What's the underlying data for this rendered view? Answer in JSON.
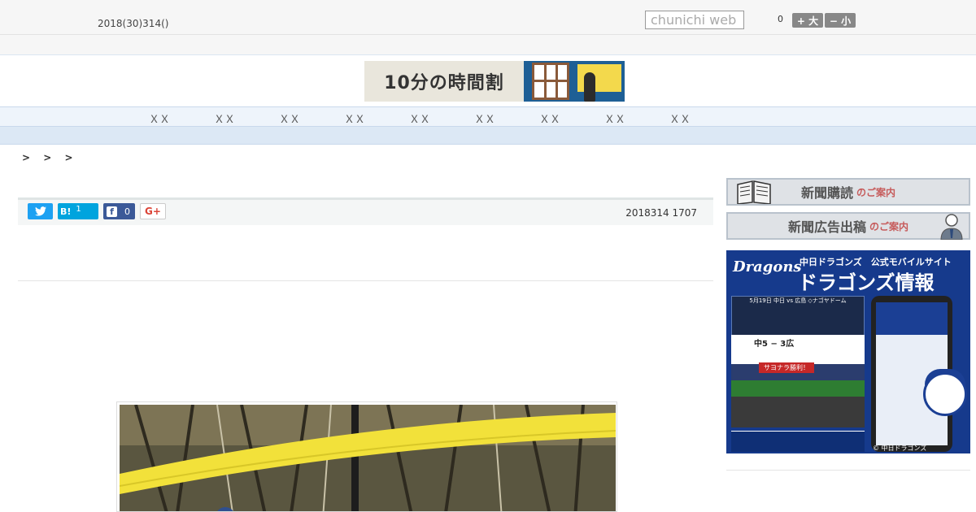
{
  "header": {
    "date": "2018(30)314()",
    "search_placeholder": "chunichi web",
    "font_count": "0",
    "font_larger": "+ 大",
    "font_smaller": "− 小"
  },
  "banner": {
    "text": "10分の時間割"
  },
  "nav": {
    "items": [
      "ＸＸ",
      "ＸＸ",
      "ＸＸ",
      "ＸＸ",
      "ＸＸ",
      "ＸＸ",
      "ＸＸ",
      "ＸＸ",
      "ＸＸ"
    ]
  },
  "breadcrumb": "> > >",
  "share": {
    "hatena_label": "B!",
    "hatena_count": "1",
    "facebook_count": "0",
    "google_label": "G+"
  },
  "article": {
    "published": "2018314 1707"
  },
  "sidebar": {
    "subscribe_main": "新聞購読",
    "subscribe_sub": "のご案内",
    "ads_main": "新聞広告出稿",
    "ads_sub": "のご案内",
    "dragons": {
      "logo": "Dragons",
      "headline_small": "中日ドラゴンズ　公式モバイルサイト",
      "headline_large": "ドラゴンズ情報",
      "board_title": "5月19日 中日 vs 広島 ◇ナゴヤドーム",
      "score": "中5 − 3広",
      "win_label": "サヨナラ勝利！",
      "copyright": "© 中日ドラゴンズ"
    }
  },
  "colors": {
    "nav_bg": "#eef4fb",
    "twitter": "#1da1f2",
    "hatena": "#00a4de",
    "facebook": "#3b5998",
    "dragons_blue": "#163a8c"
  }
}
